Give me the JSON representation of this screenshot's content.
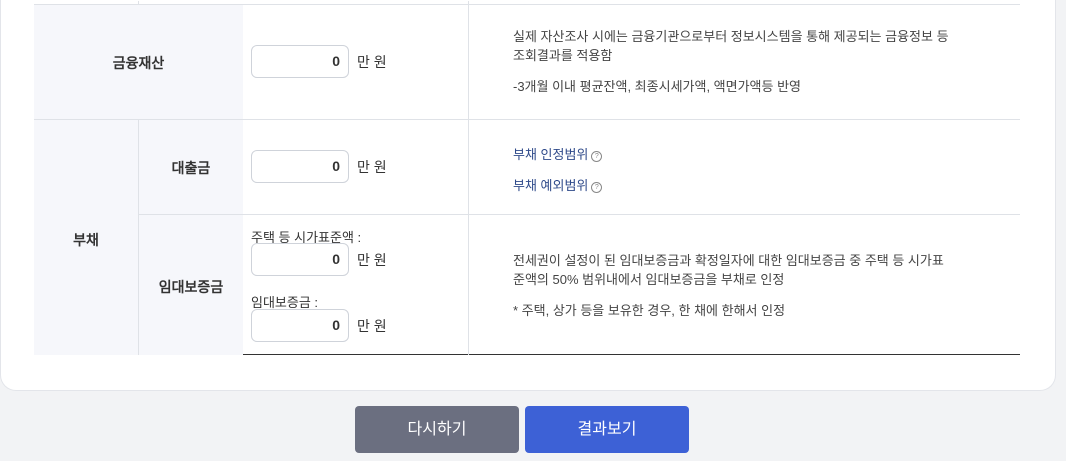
{
  "rows": {
    "financial": {
      "label": "금융재산",
      "value": "0",
      "unit": "만 원",
      "desc_line1": "실제 자산조사 시에는 금융기관으로부터 정보시스템을 통해 제공되는 금융정보 등",
      "desc_line2": "조회결과를 적용함",
      "desc_line3": "-3개월 이내 평균잔액, 최종시세가액, 액면가액등 반영"
    },
    "debt": {
      "label": "부채",
      "loan": {
        "label": "대출금",
        "value": "0",
        "unit": "만 원",
        "link1": "부채 인정범위",
        "link2": "부채 예외범위"
      },
      "deposit": {
        "label": "임대보증금",
        "sub1": "주택 등 시가표준액 :",
        "value1": "0",
        "unit1": "만 원",
        "sub2": "임대보증금 :",
        "value2": "0",
        "unit2": "만 원",
        "desc_line1": "전세권이 설정이 된 임대보증금과 확정일자에 대한 임대보증금 중 주택 등 시가표",
        "desc_line2": "준액의 50% 범위내에서 임대보증금을 부채로 인정",
        "desc_line3": "* 주택, 상가 등을 보유한 경우, 한 채에 한해서 인정"
      }
    }
  },
  "buttons": {
    "reset": "다시하기",
    "result": "결과보기"
  },
  "help_icon": "?",
  "colors": {
    "reset_button": "#6b6f80",
    "result_button": "#3d61d6",
    "link": "#2f4a8a"
  }
}
